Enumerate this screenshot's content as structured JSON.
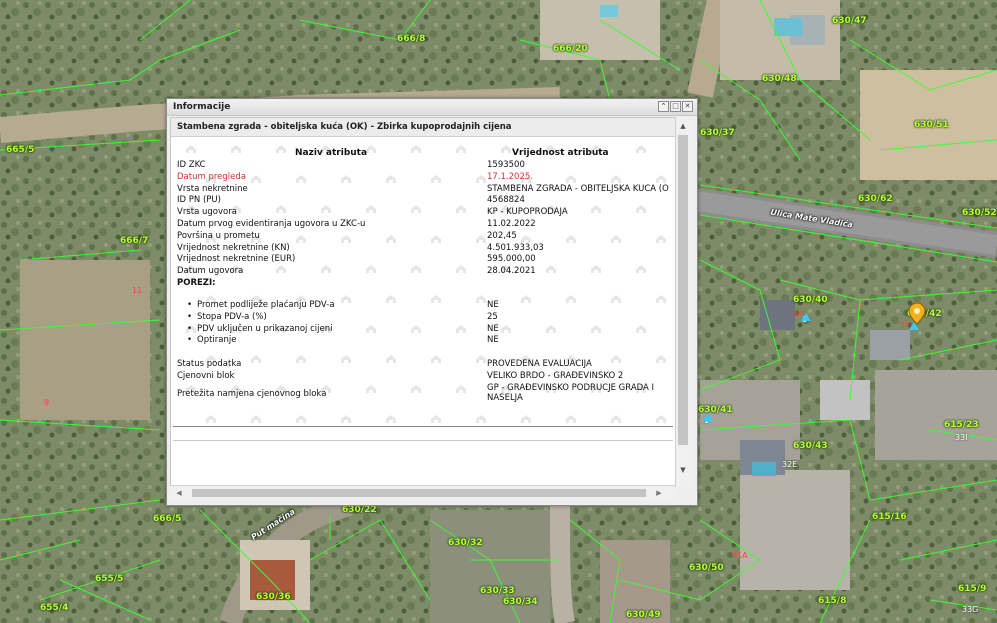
{
  "map": {
    "parcels": [
      "666/8",
      "666/20",
      "630/47",
      "630/48",
      "630/37",
      "630/51",
      "665/5",
      "666/7",
      "630/62",
      "630/52",
      "630/40",
      "630/42",
      "630/41",
      "630/43",
      "615/23",
      "615/16",
      "666/5",
      "630/32",
      "630/50",
      "655/5",
      "630/36",
      "630/33",
      "630/34",
      "655/4",
      "630/49",
      "615/8",
      "615/9",
      "630/22"
    ],
    "house_numbers": [
      "11",
      "9",
      "32F",
      "32I",
      "1",
      "1",
      "33I",
      "32E",
      "31A",
      "33G"
    ],
    "streets": [
      "Ulica Mate Vladića",
      "Put mačina"
    ],
    "colors": {
      "parcel_label": "#b8ff3a",
      "parcel_line": "#39ff2e",
      "house_number": "#ff4040",
      "pin": "#f2b21b"
    }
  },
  "info_window": {
    "title": "Informacije",
    "buttons": [
      "up-icon",
      "restore-icon",
      "close-icon"
    ],
    "section_title": "Stambena zgrada - obiteljska kuća (OK) - Zbirka kupoprodajnih cijena",
    "header": {
      "attr": "Naziv atributa",
      "value": "Vrijednost atributa"
    },
    "rows": [
      {
        "k": "ID ZKC",
        "v": "1593500"
      },
      {
        "k": "Datum pregleda",
        "v": "17.1.2025."
      },
      {
        "k": "Vrsta nekretnine",
        "v": "STAMBENA ZGRADA - OBITELJSKA KUĆA (O"
      },
      {
        "k": "ID PN (PU)",
        "v": "4568824"
      },
      {
        "k": "Vrsta ugovora",
        "v": "KP - KUPOPRODAJA"
      },
      {
        "k": "Datum prvog evidentiranja ugovora u ZKC-u",
        "v": "11.02.2022"
      },
      {
        "k": "Površina u prometu",
        "v": "202,45"
      },
      {
        "k": "Vrijednost nekretnine (KN)",
        "v": "4.501.933,03"
      },
      {
        "k": "Vrijednost nekretnine (EUR)",
        "v": "595.000,00"
      },
      {
        "k": "Datum ugovora",
        "v": "28.04.2021"
      }
    ],
    "taxes_label": "POREZI:",
    "taxes": [
      {
        "k": "Promet podliježe plaćanju PDV-a",
        "v": "NE"
      },
      {
        "k": "Stopa PDV-a (%)",
        "v": "25"
      },
      {
        "k": "PDV uključen u prikazanoj cijeni",
        "v": "NE"
      },
      {
        "k": "Optiranje",
        "v": "NE"
      }
    ],
    "tail_rows": [
      {
        "k": "Status podatka",
        "v": "PROVEDENA EVALUACIJA"
      },
      {
        "k": "Cjenovni blok",
        "v": "VELIKO BRDO - GRAĐEVINSKO 2"
      },
      {
        "k": "Pretežita namjena cjenovnog bloka",
        "v": "GP - GRAĐEVINSKO PODRUČJE GRADA I NASELJA"
      }
    ]
  }
}
